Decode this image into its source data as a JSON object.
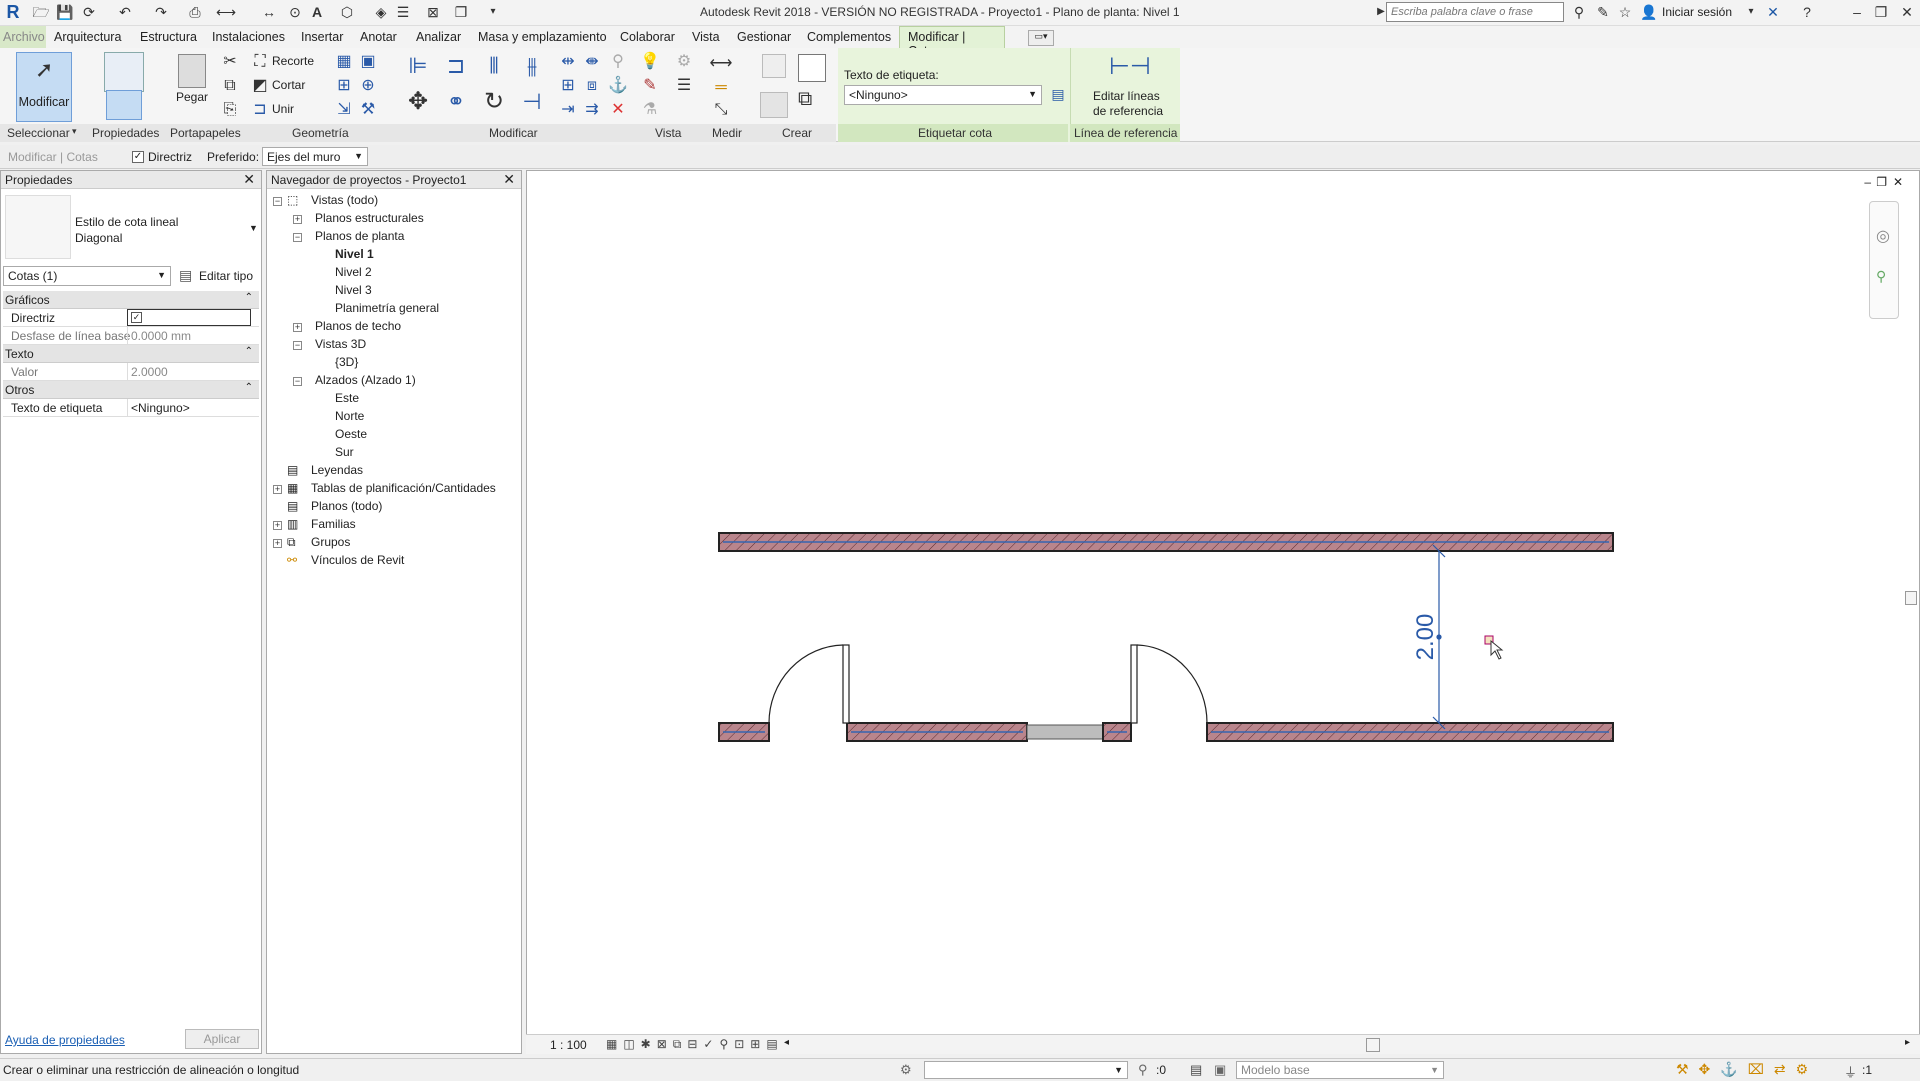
{
  "window": {
    "title": "Autodesk Revit 2018 - VERSIÓN NO REGISTRADA -    Proyecto1 - Plano de planta: Nivel 1",
    "search_placeholder": "Escriba palabra clave o frase",
    "signin": "Iniciar sesión"
  },
  "tabs": [
    "Arquitectura",
    "Estructura",
    "Instalaciones",
    "Insertar",
    "Anotar",
    "Analizar",
    "Masa y emplazamiento",
    "Colaborar",
    "Vista",
    "Gestionar",
    "Complementos"
  ],
  "tab_file": "Archivo",
  "tab_active": "Modificar | Cotas",
  "ribbon": {
    "modificar": "Modificar",
    "seleccionar": "Seleccionar",
    "propiedades": "Propiedades",
    "pegar": "Pegar",
    "portapapeles": "Portapapeles",
    "recorte": "Recorte",
    "cortar": "Cortar",
    "unir": "Unir",
    "geometria": "Geometría",
    "modificar_group": "Modificar",
    "vista": "Vista",
    "medir": "Medir",
    "crear": "Crear",
    "texto_etiqueta_label": "Texto de etiqueta:",
    "texto_etiqueta_value": "<Ninguno>",
    "etiquetar_cota": "Etiquetar cota",
    "editar_lineas_1": "Editar líneas",
    "editar_lineas_2": "de referencia",
    "linea_referencia": "Línea de referencia"
  },
  "options": {
    "context": "Modificar | Cotas",
    "directriz": "Directriz",
    "preferido_label": "Preferido:",
    "preferido_value": "Ejes del muro"
  },
  "properties": {
    "title": "Propiedades",
    "type_line1": "Estilo de cota lineal",
    "type_line2": "Diagonal",
    "selector": "Cotas (1)",
    "edit_type": "Editar tipo",
    "sec_graficos": "Gráficos",
    "directriz": "Directriz",
    "desfase_label": "Desfase de línea base",
    "desfase_value": "0.0000 mm",
    "sec_texto": "Texto",
    "valor_label": "Valor",
    "valor_value": "2.0000",
    "sec_otros": "Otros",
    "texto_etiqueta_label": "Texto de etiqueta",
    "texto_etiqueta_value": "<Ninguno>",
    "help": "Ayuda de propiedades",
    "apply": "Aplicar"
  },
  "navigator": {
    "title": "Navegador de proyectos - Proyecto1",
    "items": [
      "Vistas (todo)",
      "Planos estructurales",
      "Planos de planta",
      "Nivel 1",
      "Nivel 2",
      "Nivel 3",
      "Planimetría general",
      "Planos de techo",
      "Vistas 3D",
      "{3D}",
      "Alzados (Alzado 1)",
      "Este",
      "Norte",
      "Oeste",
      "Sur",
      "Leyendas",
      "Tablas de planificación/Cantidades",
      "Planos (todo)",
      "Familias",
      "Grupos",
      "Vínculos de Revit"
    ]
  },
  "canvas": {
    "dimension_text": "2.00",
    "scale": "1 : 100"
  },
  "status": {
    "message": "Crear o eliminar una restricción de alineación o longitud",
    "workset": "Modelo base",
    "selected": ":0",
    "filter_count": ":1"
  }
}
